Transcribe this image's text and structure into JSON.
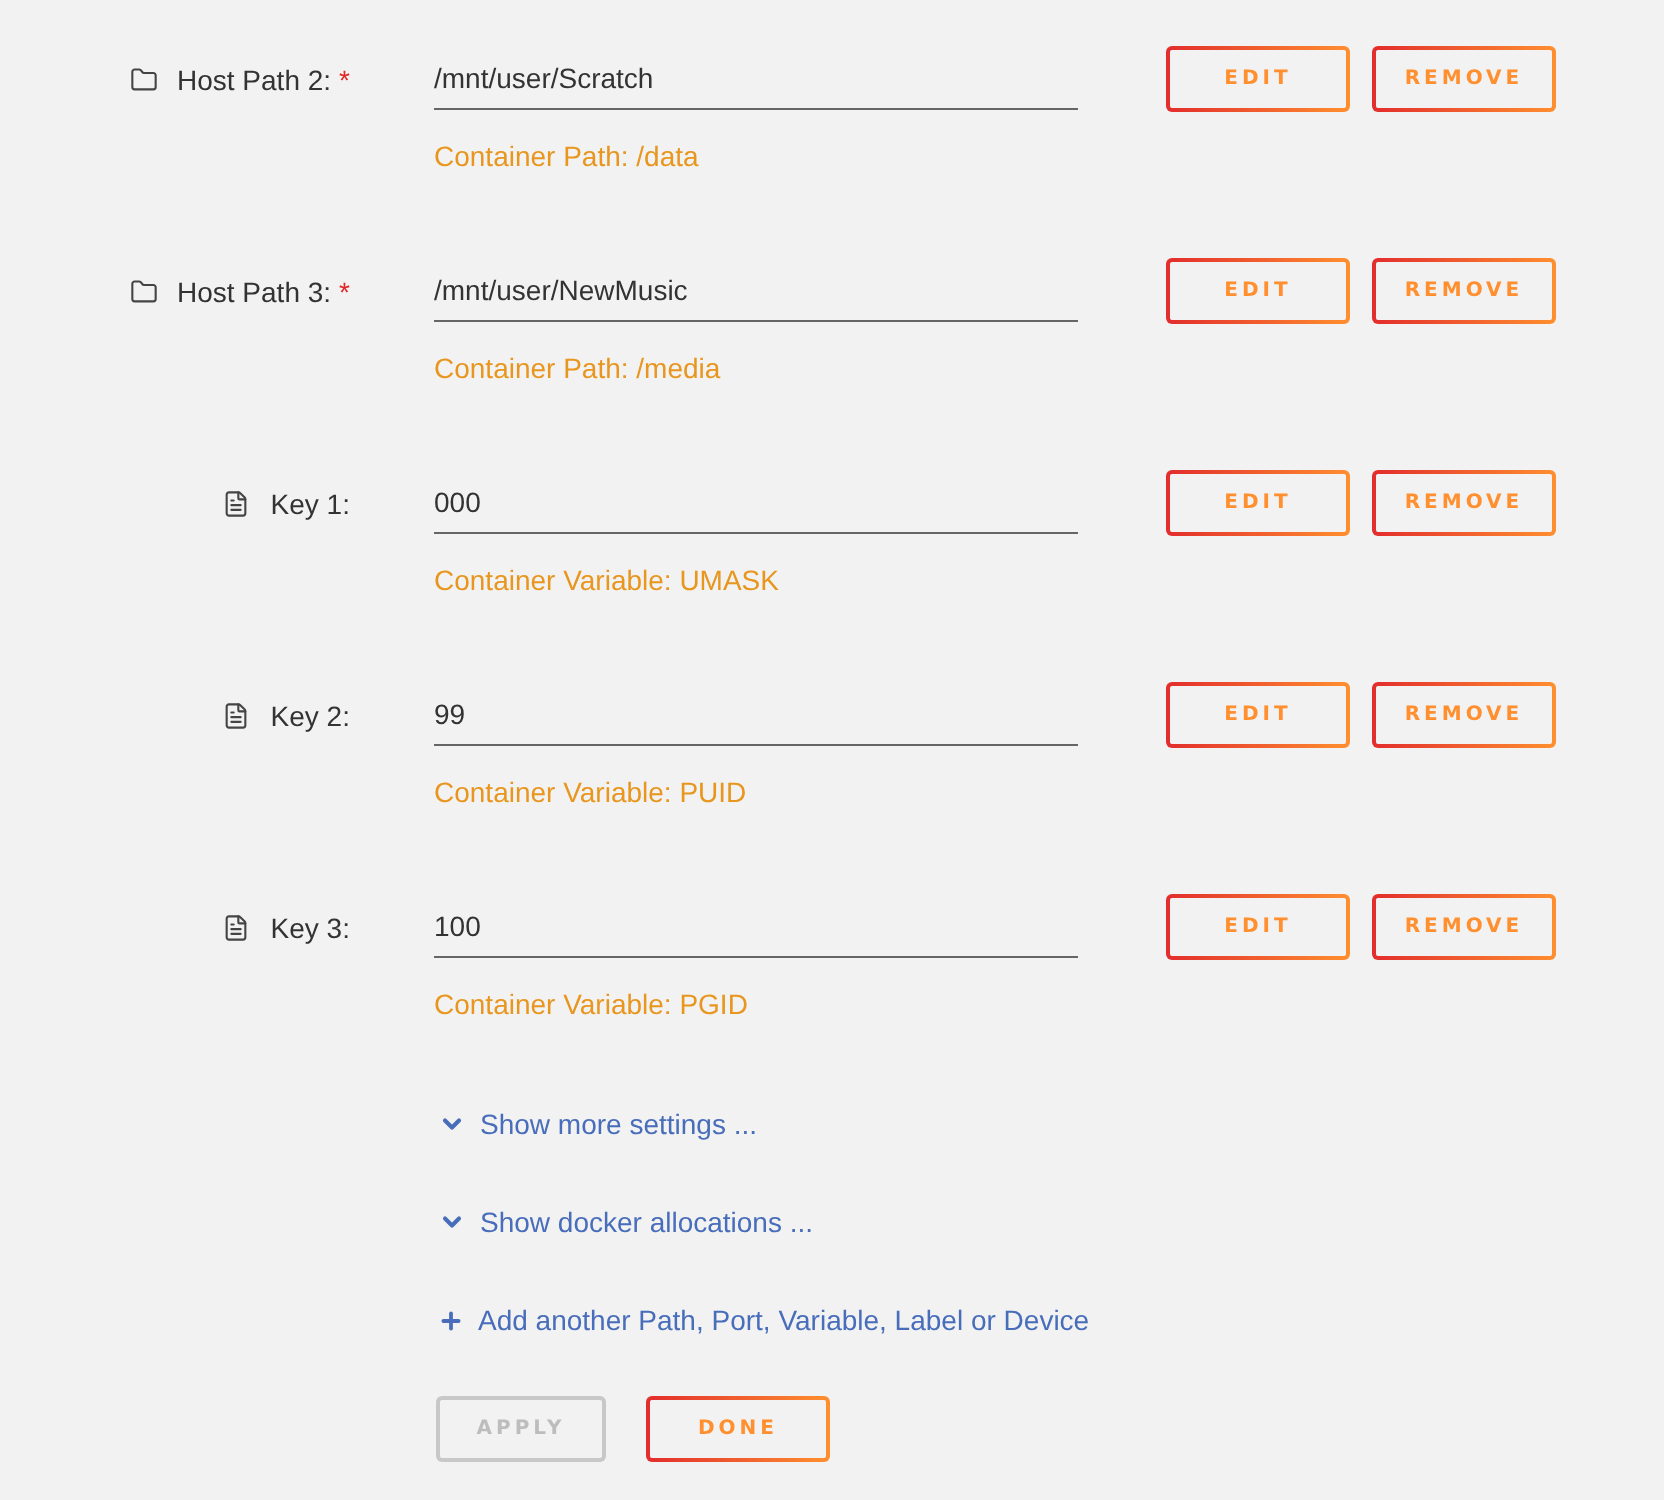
{
  "entries": [
    {
      "kind": "path",
      "label": "Host Path 2:",
      "required_mark": "*",
      "value": "/mnt/user/Scratch",
      "description": "Container Path: /data",
      "buttons": [
        "EDIT",
        "REMOVE"
      ]
    },
    {
      "kind": "path",
      "label": "Host Path 3:",
      "required_mark": "*",
      "value": "/mnt/user/NewMusic",
      "description": "Container Path: /media",
      "buttons": [
        "EDIT",
        "REMOVE"
      ]
    },
    {
      "kind": "variable",
      "label": "Key 1:",
      "value": "000",
      "description": "Container Variable: UMASK",
      "buttons": [
        "EDIT",
        "REMOVE"
      ]
    },
    {
      "kind": "variable",
      "label": "Key 2:",
      "value": "99",
      "description": "Container Variable: PUID",
      "buttons": [
        "EDIT",
        "REMOVE"
      ]
    },
    {
      "kind": "variable",
      "label": "Key 3:",
      "value": "100",
      "description": "Container Variable: PGID",
      "buttons": [
        "EDIT",
        "REMOVE"
      ]
    }
  ],
  "links": [
    {
      "kind": "expand",
      "label": "Show more settings ..."
    },
    {
      "kind": "expand",
      "label": "Show docker allocations ..."
    },
    {
      "kind": "add",
      "label": "Add another Path, Port, Variable, Label or Device"
    }
  ],
  "actions": [
    {
      "label": "APPLY",
      "disabled": true
    },
    {
      "label": "DONE",
      "disabled": false
    }
  ]
}
